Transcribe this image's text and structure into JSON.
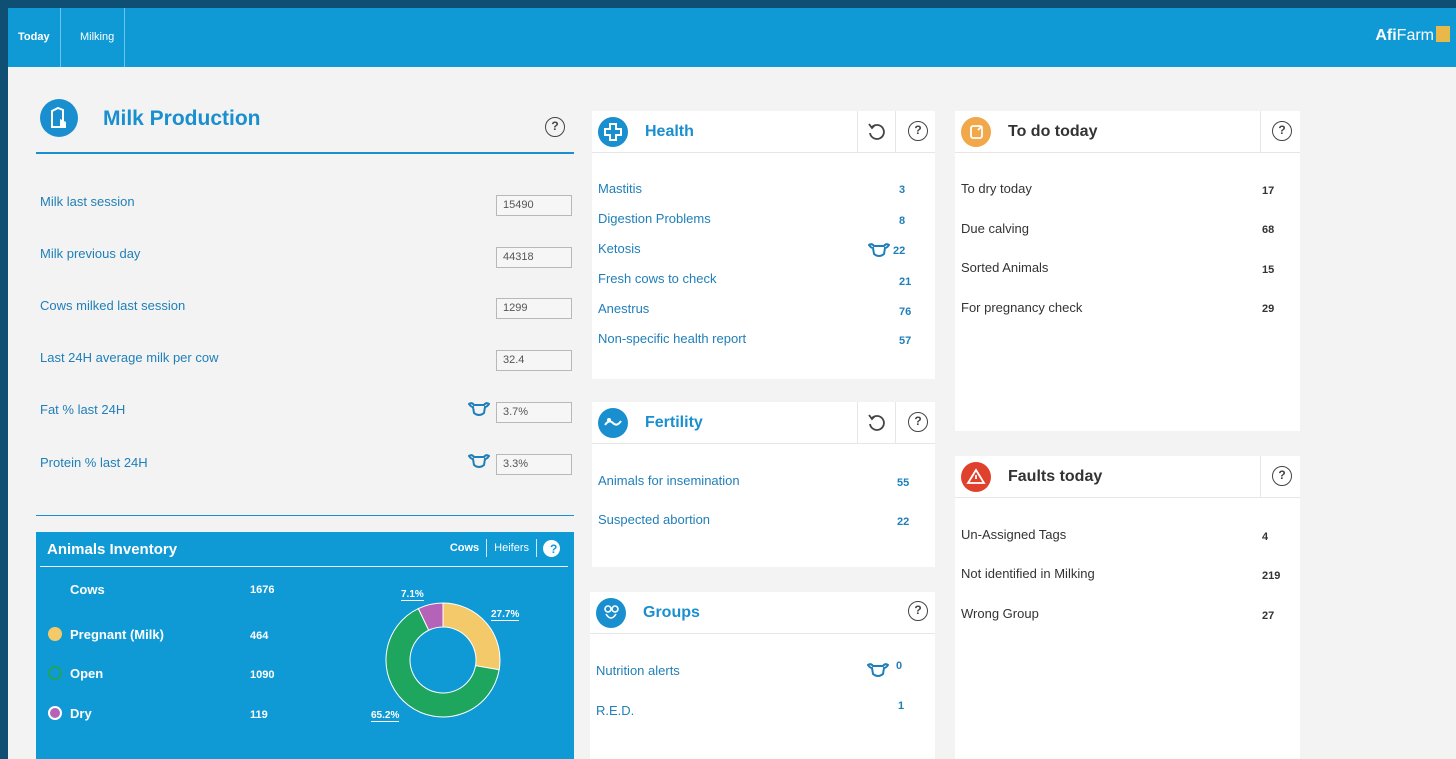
{
  "nav": {
    "tabs": [
      {
        "label": "Today"
      },
      {
        "label": "Milking"
      }
    ]
  },
  "brand": {
    "name_bold": "Afi",
    "name_light": "Farm"
  },
  "milk_production": {
    "title": "Milk Production",
    "rows": [
      {
        "label": "Milk last session",
        "value": "15490"
      },
      {
        "label": "Milk previous day",
        "value": "44318"
      },
      {
        "label": "Cows milked last session",
        "value": "1299"
      },
      {
        "label": "Last 24H average milk per cow",
        "value": "32.4"
      },
      {
        "label": "Fat % last 24H",
        "value": "3.7%"
      },
      {
        "label": "Protein % last 24H",
        "value": "3.3%"
      }
    ]
  },
  "inventory": {
    "title": "Animals Inventory",
    "tabs": [
      "Cows",
      "Heifers"
    ],
    "help": "?",
    "total": {
      "label": "Cows",
      "value": "1676"
    },
    "rows": [
      {
        "label": "Pregnant (Milk)",
        "value": "464",
        "color": "#f3c96a"
      },
      {
        "label": "Open",
        "value": "1090",
        "color": "#1ea55e"
      },
      {
        "label": "Dry",
        "value": "119",
        "color": "#b463b8"
      }
    ],
    "labels": [
      "7.1%",
      "27.7%",
      "65.2%"
    ]
  },
  "chart_data": {
    "type": "pie",
    "categories": [
      "Pregnant (Milk)",
      "Open",
      "Dry"
    ],
    "values": [
      464,
      1090,
      119
    ],
    "percent_labels": [
      "27.7%",
      "65.2%",
      "7.1%"
    ],
    "colors": [
      "#f3c96a",
      "#1ea55e",
      "#b463b8"
    ]
  },
  "health": {
    "title": "Health",
    "items": [
      {
        "label": "Mastitis",
        "value": "3"
      },
      {
        "label": "Digestion Problems",
        "value": "8"
      },
      {
        "label": "Ketosis",
        "value": "22"
      },
      {
        "label": "Fresh cows to check",
        "value": "21"
      },
      {
        "label": "Anestrus",
        "value": "76"
      },
      {
        "label": "Non-specific health report",
        "value": "57"
      }
    ]
  },
  "fertility": {
    "title": "Fertility",
    "items": [
      {
        "label": "Animals for insemination",
        "value": "55"
      },
      {
        "label": "Suspected abortion",
        "value": "22"
      }
    ]
  },
  "groups": {
    "title": "Groups",
    "items": [
      {
        "label": "Nutrition alerts",
        "value": "0"
      },
      {
        "label": "R.E.D.",
        "value": "1"
      }
    ]
  },
  "todo": {
    "title": "To do today",
    "items": [
      {
        "label": "To dry today",
        "value": "17"
      },
      {
        "label": "Due calving",
        "value": "68"
      },
      {
        "label": "Sorted Animals",
        "value": "15"
      },
      {
        "label": "For pregnancy check",
        "value": "29"
      }
    ]
  },
  "faults": {
    "title": "Faults today",
    "items": [
      {
        "label": "Un-Assigned Tags",
        "value": "4"
      },
      {
        "label": "Not identified in Milking",
        "value": "219"
      },
      {
        "label": "Wrong Group",
        "value": "27"
      }
    ]
  },
  "common": {
    "help": "?"
  },
  "colors": {
    "primary": "#0f9ad6",
    "link": "#1f7fb8",
    "orange": "#f0a84a",
    "red": "#e0412d"
  },
  "icons": [
    "milk-icon",
    "help-icon",
    "cow-icon",
    "health-cross-icon",
    "refresh-icon",
    "fertility-icon",
    "groups-icon",
    "todo-icon",
    "warning-icon"
  ]
}
